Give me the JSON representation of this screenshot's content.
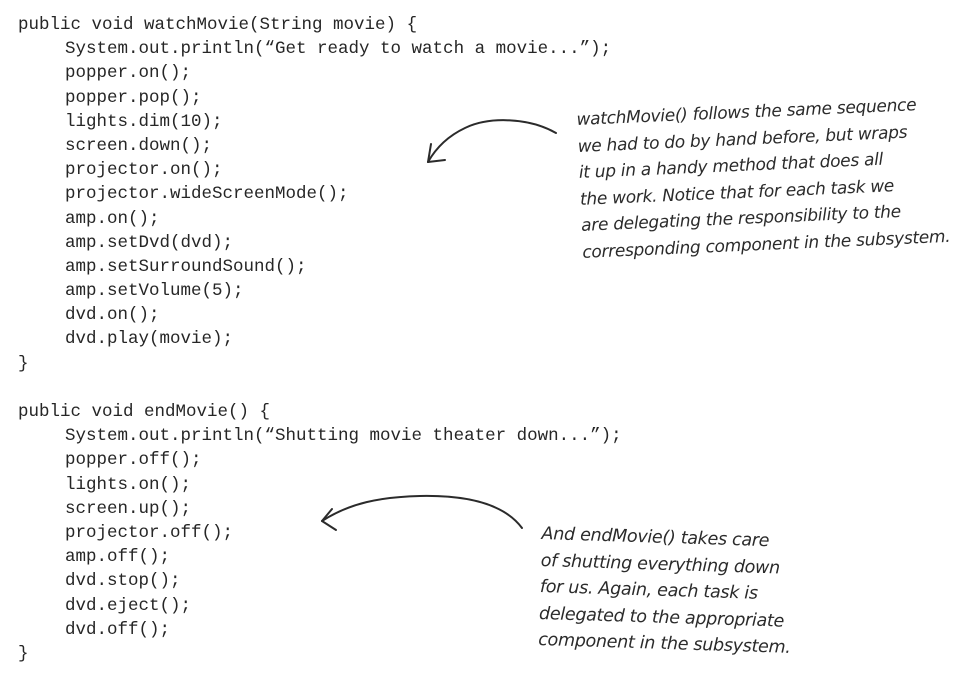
{
  "code": {
    "watch_movie": [
      "public void watchMovie(String movie) {",
      "System.out.println(“Get ready to watch a movie...”);",
      "popper.on();",
      "popper.pop();",
      "lights.dim(10);",
      "screen.down();",
      "projector.on();",
      "projector.wideScreenMode();",
      "amp.on();",
      "amp.setDvd(dvd);",
      "amp.setSurroundSound();",
      "amp.setVolume(5);",
      "dvd.on();",
      "dvd.play(movie);",
      "}"
    ],
    "end_movie": [
      "public void endMovie() {",
      "System.out.println(“Shutting movie theater down...”);",
      "popper.off();",
      "lights.on();",
      "screen.up();",
      "projector.off();",
      "amp.off();",
      "dvd.stop();",
      "dvd.eject();",
      "dvd.off();",
      "}"
    ]
  },
  "annotations": {
    "watch_movie_note": [
      "watchMovie() follows the same sequence",
      "we had to do by hand before, but wraps",
      "it up in a handy method that does all",
      "the work.  Notice that for each task we",
      "are delegating the responsibility to the",
      "corresponding component in the subsystem."
    ],
    "end_movie_note": [
      "And endMovie() takes care",
      "of shutting everything down",
      "for us.  Again, each task is",
      "delegated to the appropriate",
      "component in the subsystem."
    ]
  },
  "icons": {
    "arrow_watch": "curved-arrow-left-icon",
    "arrow_end": "curved-arrow-left-icon"
  },
  "colors": {
    "text": "#262626",
    "handwriting": "#2b2b2b"
  }
}
